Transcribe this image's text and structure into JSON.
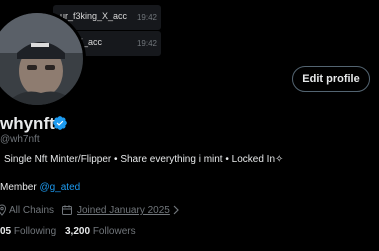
{
  "chat": {
    "messages": [
      {
        "text": "ur_f3king_X_acc",
        "time": "19:42"
      },
      {
        "text": "ing_X_acc",
        "time": "19:42"
      }
    ]
  },
  "header": {
    "edit_profile_label": "Edit profile"
  },
  "profile": {
    "display_name": "whynft",
    "handle": "@wh7nft",
    "bio": "Single Nft Minter/Flipper • Share everything i mint • Locked In✧",
    "member_prefix": "Member ",
    "member_of": "@g_ated",
    "location": "All Chains",
    "joined": "Joined January 2025",
    "following_count": "05",
    "following_label": "Following",
    "followers_count": "3,200",
    "followers_label": "Followers"
  },
  "icons": {
    "verified": "verified-badge-icon",
    "location": "location-pin-icon",
    "calendar": "calendar-icon",
    "chevron": "chevron-right-icon"
  },
  "colors": {
    "background": "#000000",
    "accent": "#1d9bf0",
    "muted": "#71767b",
    "text": "#e7e9ea"
  }
}
